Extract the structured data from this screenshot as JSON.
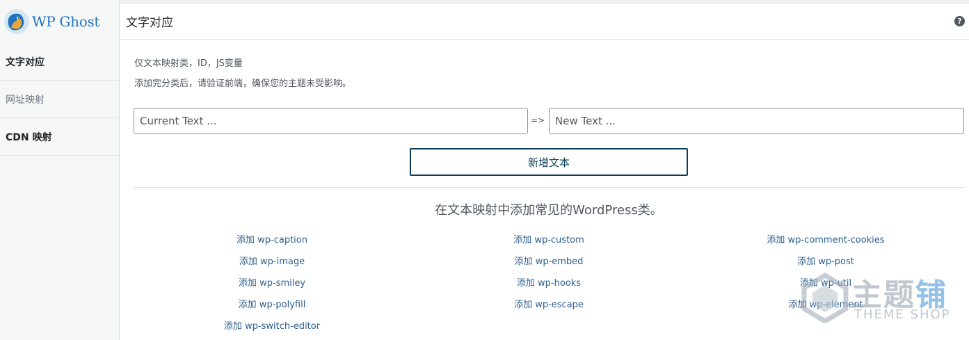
{
  "brand": {
    "name": "WP Ghost"
  },
  "sidebar": {
    "items": [
      {
        "label": "文字对应"
      },
      {
        "label": "网址映射"
      },
      {
        "label": "CDN 映射"
      }
    ]
  },
  "header": {
    "title": "文字对应",
    "help": "?"
  },
  "notes": {
    "line1": "仅文本映射类，ID，JS变量",
    "line2": "添加完分类后，请验证前端，确保您的主题未受影响。"
  },
  "mapping": {
    "current_placeholder": "Current Text ...",
    "arrow": "=>",
    "new_placeholder": "New Text ...",
    "add_label": "新增文本"
  },
  "classes": {
    "title": "在文本映射中添加常见的WordPress类。",
    "col1": [
      "添加 wp-caption",
      "添加 wp-image",
      "添加 wp-smiley",
      "添加 wp-polyfill",
      "添加 wp-switch-editor"
    ],
    "col2": [
      "添加 wp-custom",
      "添加 wp-embed",
      "添加 wp-hooks",
      "添加 wp-escape"
    ],
    "col3": [
      "添加 wp-comment-cookies",
      "添加 wp-post",
      "添加 wp-util",
      "添加 wp-element"
    ]
  },
  "watermark": {
    "title_a": "主题",
    "title_b": "铺",
    "subtitle": "THEME SHOP"
  },
  "colors": {
    "accent": "#0b3d56",
    "link": "#2c5d8f",
    "brand": "#1e73be"
  }
}
